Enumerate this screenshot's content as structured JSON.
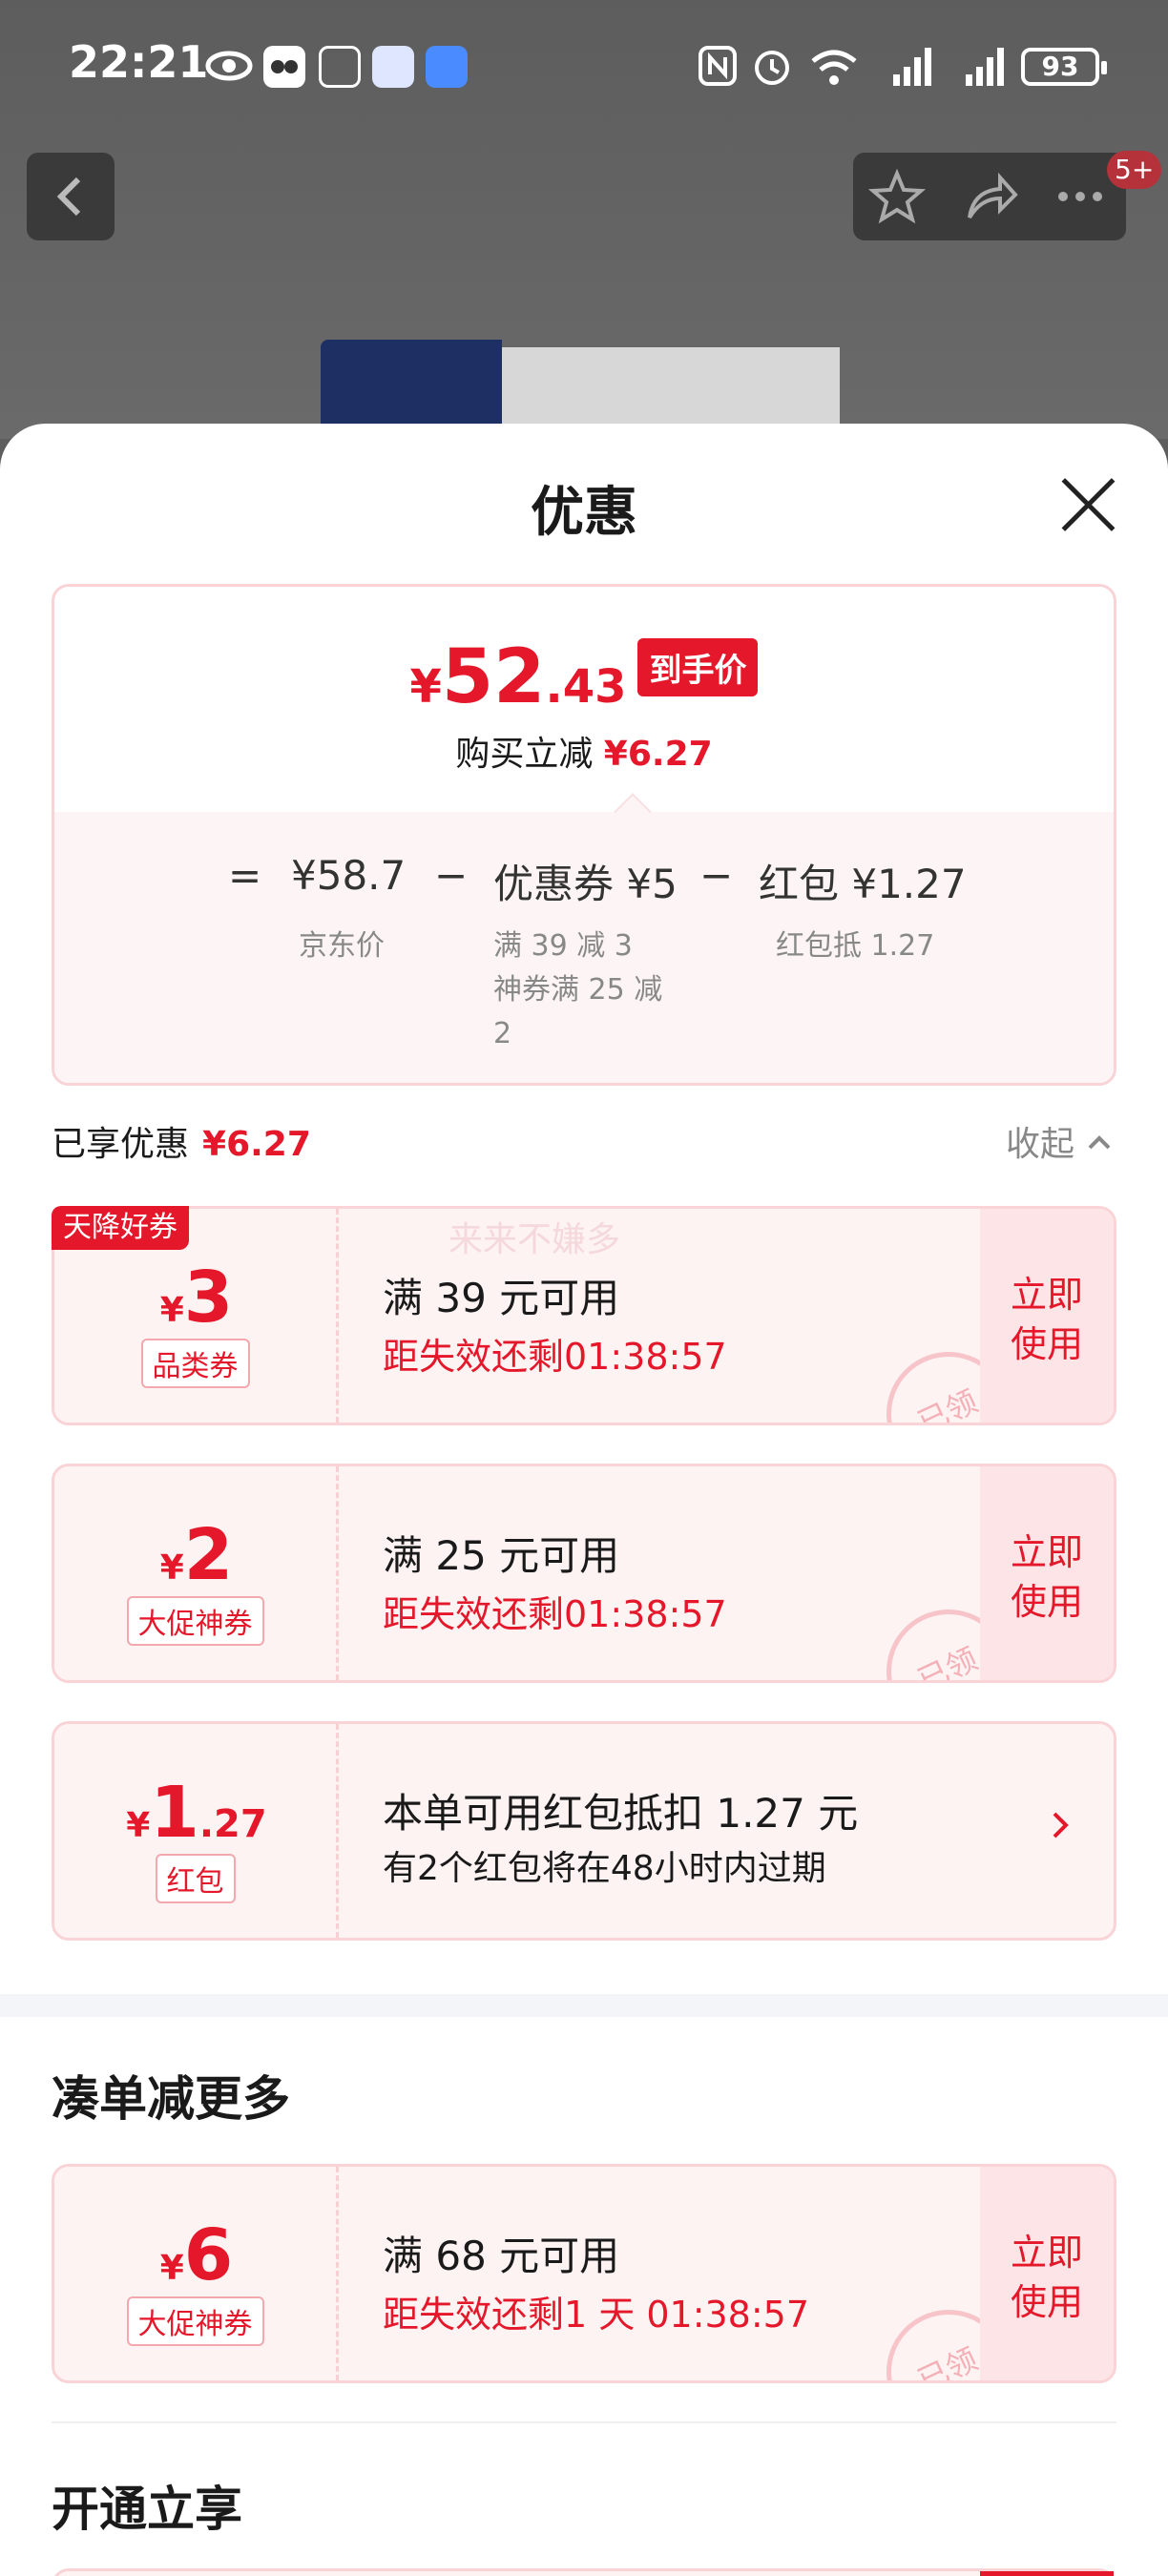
{
  "status": {
    "time": "22:21",
    "battery": "93"
  },
  "topbar": {
    "notification_count": "5+"
  },
  "sheet": {
    "title": "优惠",
    "summary": {
      "currency": "¥",
      "price_int": "52",
      "price_dec": ".43",
      "price_tag": "到手价",
      "reduce_label": "购买立减",
      "reduce_value": "¥6.27",
      "equals": "=",
      "base_price": "¥58.7",
      "base_label": "京东价",
      "minus1": "−",
      "coupon_label": "优惠券 ¥5",
      "coupon_detail1": "满 39 减 3",
      "coupon_detail2": "神券满 25 减 2",
      "minus2": "−",
      "redpacket_label": "红包 ¥1.27",
      "redpacket_detail": "红包抵 1.27"
    },
    "enjoyed": {
      "label": "已享优惠",
      "value": "¥6.27",
      "collapse": "收起"
    },
    "coupons": [
      {
        "sky_tag": "天降好券",
        "watermark": "来来不嫌多",
        "yen": "¥",
        "amount": "3",
        "type": "品类券",
        "condition": "满 39 元可用",
        "expire": "距失效还剩01:38:57",
        "action": "立即\n使用",
        "stamp": "已领"
      },
      {
        "yen": "¥",
        "amount": "2",
        "type": "大促神券",
        "condition": "满 25 元可用",
        "expire": "距失效还剩01:38:57",
        "action": "立即\n使用",
        "stamp": "已领"
      }
    ],
    "redpacket": {
      "yen": "¥",
      "amount": "1",
      "amount_dec": ".27",
      "type": "红包",
      "line1": "本单可用红包抵扣 1.27 元",
      "line2": "有2个红包将在48小时内过期"
    },
    "more_section": {
      "title": "凑单减更多",
      "coupon": {
        "yen": "¥",
        "amount": "6",
        "type": "大促神券",
        "condition": "满 68 元可用",
        "expire": "距失效还剩1 天 01:38:57",
        "action": "立即\n使用",
        "stamp": "已领"
      }
    },
    "open_section": {
      "title": "开通立享"
    }
  },
  "colors": {
    "accent_red": "#e4182a",
    "coupon_bg": "#fdf3f3",
    "coupon_border": "#f9d3d6"
  }
}
